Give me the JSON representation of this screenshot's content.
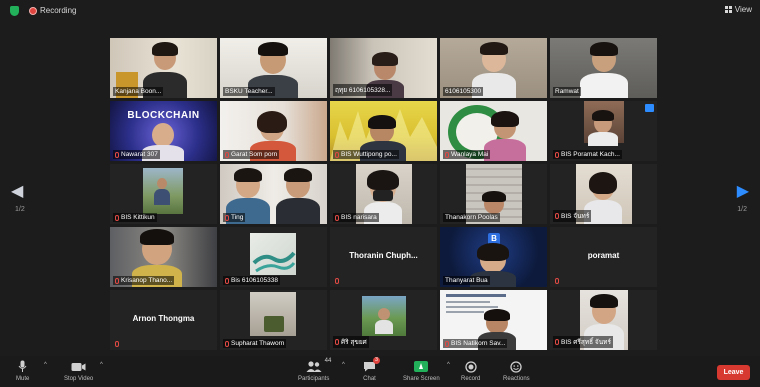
{
  "topbar": {
    "recording_label": "Recording",
    "view_label": "View"
  },
  "colors": {
    "accent": "#2d8cff",
    "speaking_border": "#c8dd3b",
    "leave": "#d7382f",
    "share": "#23b05a",
    "muted": "#e24a44"
  },
  "pagination": {
    "left_page": "1/2",
    "right_page": "1/2"
  },
  "participants": [
    {
      "name": "Kanjana Boon...",
      "muted": false
    },
    {
      "name": "BSKU Teacher...",
      "muted": false,
      "speaking": true
    },
    {
      "name": "ฤทุย 6106105328...",
      "muted": false
    },
    {
      "name": "6106105300",
      "muted": false
    },
    {
      "name": "Ramwat",
      "muted": false
    },
    {
      "name": "Nawarat 307",
      "muted": true
    },
    {
      "name": "Garat Som porn",
      "muted": true
    },
    {
      "name": "BIS Wuttipong po...",
      "muted": true
    },
    {
      "name": "Wanlaya Mai",
      "muted": true
    },
    {
      "name": "BIS Poramat Kach...",
      "muted": true
    },
    {
      "name": "BIS Kittikun",
      "muted": true
    },
    {
      "name": "Ting",
      "muted": true
    },
    {
      "name": "BIS narisara",
      "muted": true
    },
    {
      "name": "Thanakorn Poolas",
      "muted": false
    },
    {
      "name": "BIS จันทร์",
      "muted": true
    },
    {
      "name": "Krisanop Thano...",
      "muted": true
    },
    {
      "name": "Bis 6106105338",
      "muted": true
    },
    {
      "name": "",
      "display": "Thoranin Chuph...",
      "muted": true
    },
    {
      "name": "Thanyarat Bua",
      "muted": false
    },
    {
      "name": "",
      "display": "poramat",
      "muted": true
    },
    {
      "name": "",
      "display": "Arnon Thongma",
      "muted": true
    },
    {
      "name": "Supharat Thaworn",
      "muted": true
    },
    {
      "name": "ศิริ สุขยศ",
      "muted": true
    },
    {
      "name": "BIS Natikorn Sav...",
      "muted": true
    },
    {
      "name": "BIS ศรีสุทธิ์ จันทร์",
      "muted": true
    }
  ],
  "tile_text": {
    "blockchain_banner": "BLOCKCHAIN",
    "avatar_initial": "B"
  },
  "toolbar": {
    "mute_label": "Mute",
    "video_label": "Stop Video",
    "participants_label": "Participants",
    "participants_count": "44",
    "chat_label": "Chat",
    "chat_badge": "3",
    "share_label": "Share Screen",
    "record_label": "Record",
    "reactions_label": "Reactions",
    "leave_label": "Leave"
  },
  "icons": [
    "shield-icon",
    "record-icon",
    "gallery-view-icon",
    "chevron-left-icon",
    "chevron-right-icon",
    "microphone-icon",
    "video-camera-icon",
    "participants-icon",
    "chat-icon",
    "share-screen-icon",
    "record-button-icon",
    "reactions-icon",
    "mic-off-icon"
  ]
}
